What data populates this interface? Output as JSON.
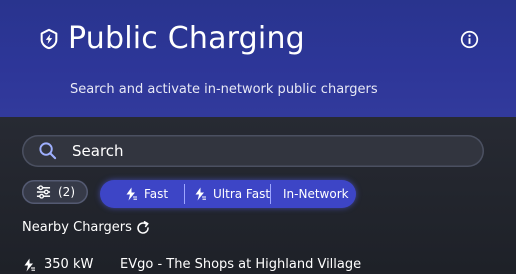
{
  "header": {
    "title": "Public Charging",
    "subtitle": "Search and activate in-network public chargers",
    "icon": "badge-lightning-icon",
    "info_icon": "info-icon"
  },
  "search": {
    "placeholder": "Search",
    "icon": "search-icon"
  },
  "filters": {
    "count_label": "(2)",
    "icon": "sliders-icon",
    "chips": [
      {
        "label": "Fast",
        "icon": "bolt-icon"
      },
      {
        "label": "Ultra Fast",
        "icon": "bolt-icon"
      },
      {
        "label": "In-Network"
      }
    ],
    "accent": "#3d45c6"
  },
  "nearby": {
    "label": "Nearby Chargers",
    "refresh_icon": "refresh-icon",
    "items": [
      {
        "power": "350 kW",
        "name": "EVgo - The Shops at Highland Village"
      }
    ]
  }
}
